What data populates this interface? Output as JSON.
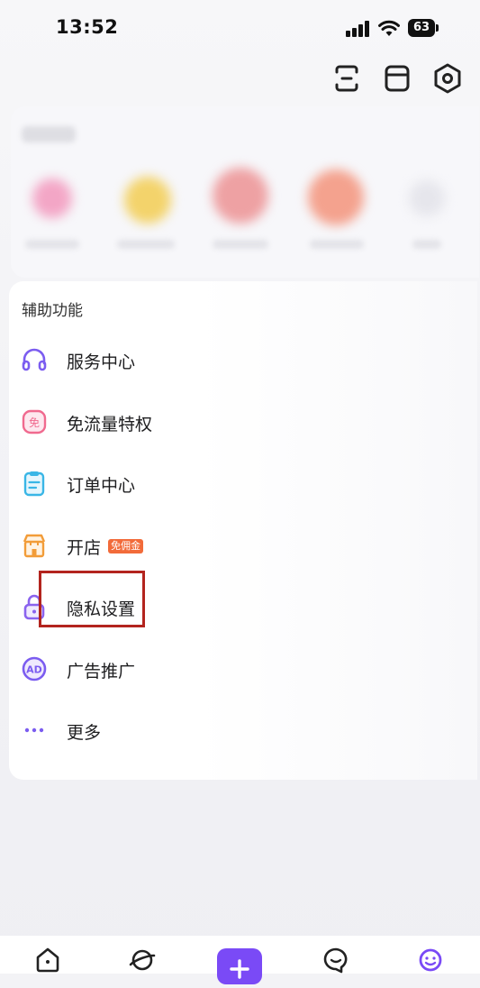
{
  "status_bar": {
    "time": "13:52",
    "battery": "63"
  },
  "top_icons": [
    "scan-icon",
    "store-box-icon",
    "settings-hex-icon"
  ],
  "section": {
    "title": "辅助功能"
  },
  "menu_items": [
    {
      "label": "服务中心",
      "icon": "headset-icon"
    },
    {
      "label": "免流量特权",
      "icon": "free-data-icon",
      "icon_text": "免"
    },
    {
      "label": "订单中心",
      "icon": "clipboard-icon"
    },
    {
      "label": "开店",
      "icon": "shop-icon",
      "badge": "免佣金"
    },
    {
      "label": "隐私设置",
      "icon": "lock-icon"
    },
    {
      "label": "广告推广",
      "icon": "ad-icon",
      "icon_text": "AD"
    },
    {
      "label": "更多",
      "icon": "more-dots-icon"
    }
  ],
  "bottom_nav": [
    {
      "name": "home-icon"
    },
    {
      "name": "planet-icon"
    },
    {
      "name": "plus-icon",
      "label": "+"
    },
    {
      "name": "message-icon"
    },
    {
      "name": "profile-icon"
    }
  ],
  "colors": {
    "accent": "#7a4af6",
    "highlight": "#b3241e",
    "badge": "#f26b3a",
    "icon_purple": "#7b5cf0",
    "icon_pink": "#f06a8f",
    "icon_cyan": "#39b6e6",
    "icon_orange": "#f29c38"
  }
}
